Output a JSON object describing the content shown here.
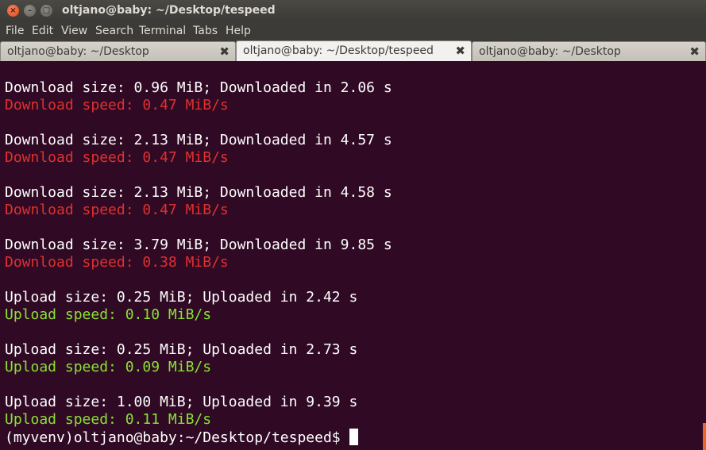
{
  "window": {
    "title": "oltjano@baby: ~/Desktop/tespeed",
    "close_glyph": "×",
    "min_glyph": "–",
    "max_glyph": "□"
  },
  "menu": [
    "File",
    "Edit",
    "View",
    "Search",
    "Terminal",
    "Tabs",
    "Help"
  ],
  "tabs": [
    {
      "label": "oltjano@baby: ~/Desktop",
      "active": false
    },
    {
      "label": "oltjano@baby: ~/Desktop/tespeed",
      "active": true
    },
    {
      "label": "oltjano@baby: ~/Desktop",
      "active": false
    }
  ],
  "tab_close_glyph": "✖",
  "colors": {
    "terminal_bg": "#300a24",
    "download_speed": "#e0302f",
    "upload_speed": "#8ae234",
    "text": "#ffffff"
  },
  "terminal": {
    "lines": [
      "Download size: 0.96 MiB; Downloaded in 2.06 s",
      "Download speed: 0.47 MiB/s",
      "Download size: 2.13 MiB; Downloaded in 4.57 s",
      "Download speed: 0.47 MiB/s",
      "Download size: 2.13 MiB; Downloaded in 4.58 s",
      "Download speed: 0.47 MiB/s",
      "Download size: 3.79 MiB; Downloaded in 9.85 s",
      "Download speed: 0.38 MiB/s",
      "Upload size: 0.25 MiB; Uploaded in 2.42 s",
      "Upload speed: 0.10 MiB/s",
      "Upload size: 0.25 MiB; Uploaded in 2.73 s",
      "Upload speed: 0.09 MiB/s",
      "Upload size: 1.00 MiB; Uploaded in 9.39 s",
      "Upload speed: 0.11 MiB/s"
    ],
    "prompt": "(myvenv)oltjano@baby:~/Desktop/tespeed$"
  }
}
